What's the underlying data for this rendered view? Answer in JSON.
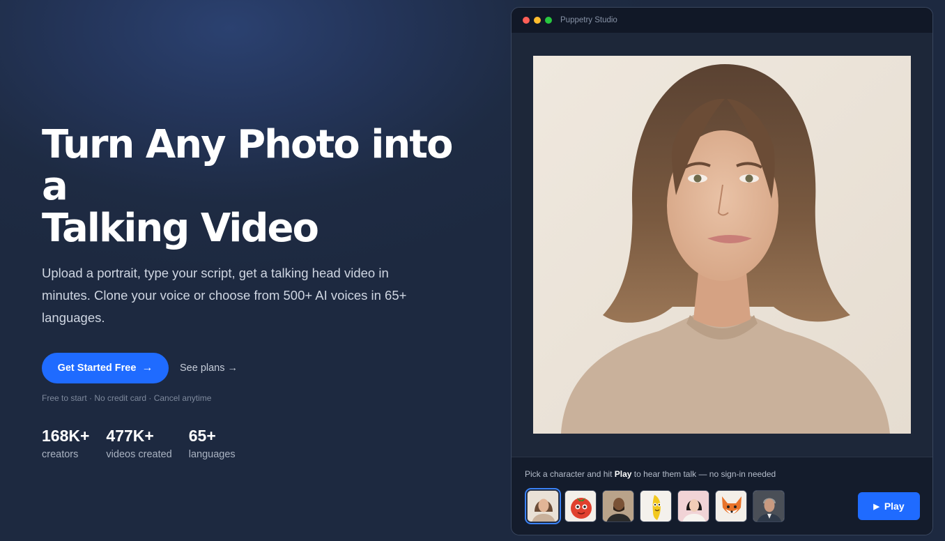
{
  "hero": {
    "title_line1": "Turn Any Photo into a",
    "title_line2": "Talking Video",
    "subtitle": "Upload a portrait, type your script, get a talking head video in minutes. Clone your voice or choose from 500+ AI voices in 65+ languages.",
    "cta_primary": "Get Started Free",
    "cta_secondary": "See plans →",
    "fine_print": "Free to start · No credit card · Cancel anytime"
  },
  "stats": [
    {
      "value": "168K+",
      "label": "creators"
    },
    {
      "value": "477K+",
      "label": "videos created"
    },
    {
      "value": "65+",
      "label": "languages"
    }
  ],
  "studio": {
    "window_title": "Puppetry Studio",
    "hint_prefix": "Pick a character and hit ",
    "hint_bold": "Play",
    "hint_suffix": " to hear them talk — no sign-in needed",
    "play_label": "Play",
    "selected_character": "woman-brown-hair",
    "characters": [
      "woman-brown-hair",
      "tomato-mascot",
      "bearded-man",
      "banana-mascot",
      "asian-woman",
      "fox-mascot",
      "older-man"
    ]
  },
  "colors": {
    "accent": "#1f6bff",
    "background": "#1e2a40",
    "selected_outline": "#3b82f6"
  }
}
